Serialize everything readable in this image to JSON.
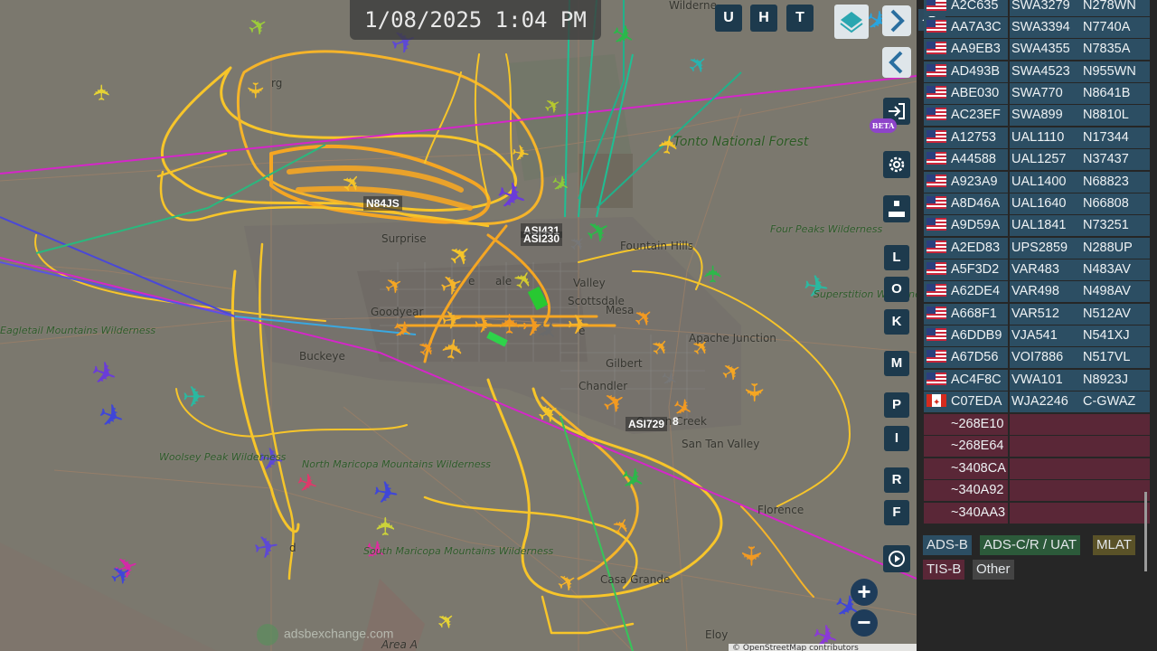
{
  "clock": {
    "datetime": "1/08/2025 1:04 PM"
  },
  "top_buttons": [
    "U",
    "H",
    "T"
  ],
  "side_buttons": [
    "L",
    "O",
    "K",
    "M",
    "P",
    "I",
    "R",
    "F"
  ],
  "beta_label": "BETA",
  "map": {
    "watermark": "adsbexchange.com",
    "attribution": "© OpenStreetMap contributors",
    "places": {
      "surprise": "Surprise",
      "goodyear": "Goodyear",
      "buckeye": "Buckeye",
      "mesa": "Mesa",
      "gilbert": "Gilbert",
      "chandler": "Chandler",
      "fountain_hills": "Fountain Hills",
      "apache_junction": "Apache Junction",
      "san_tan_valley": "San Tan Valley",
      "casa_grande": "Casa Grande",
      "eloy": "Eloy",
      "florence": "Florence",
      "queen_creek": "Queen Creek",
      "scottsdale": "Scottsdale",
      "paradise_valley": "Valley",
      "tonto": "Tonto National Forest",
      "four_peaks": "Four Peaks Wilderness",
      "superstition": "Superstition Wilderness",
      "eagletail": "Eagletail Mountains Wilderness",
      "woolsey": "Woolsey Peak Wilderness",
      "north_maricopa": "North Maricopa Mountains Wilderness",
      "south_maricopa": "South Maricopa Mountains Wilderness",
      "wickenburg": "rg",
      "wilderness_top": "Wilderne",
      "area_a": "Area A",
      "el_mirage": "e",
      "ak_chin": "d",
      "glendale": "ale",
      "tempe": "e"
    },
    "labels": {
      "n84js": "N84JS",
      "asi431": "ASI431",
      "asi230": "ASI230",
      "asi72": "ASI729",
      "asi8": "8"
    }
  },
  "aircraft_table": [
    {
      "hex": "A2C635",
      "callsign": "SWA3279",
      "reg": "N278WN",
      "flag": "us"
    },
    {
      "hex": "AA7A3C",
      "callsign": "SWA3394",
      "reg": "N7740A",
      "flag": "us"
    },
    {
      "hex": "AA9EB3",
      "callsign": "SWA4355",
      "reg": "N7835A",
      "flag": "us"
    },
    {
      "hex": "AD493B",
      "callsign": "SWA4523",
      "reg": "N955WN",
      "flag": "us"
    },
    {
      "hex": "ABE030",
      "callsign": "SWA770",
      "reg": "N8641B",
      "flag": "us"
    },
    {
      "hex": "AC23EF",
      "callsign": "SWA899",
      "reg": "N8810L",
      "flag": "us"
    },
    {
      "hex": "A12753",
      "callsign": "UAL1110",
      "reg": "N17344",
      "flag": "us"
    },
    {
      "hex": "A44588",
      "callsign": "UAL1257",
      "reg": "N37437",
      "flag": "us"
    },
    {
      "hex": "A923A9",
      "callsign": "UAL1400",
      "reg": "N68823",
      "flag": "us"
    },
    {
      "hex": "A8D46A",
      "callsign": "UAL1640",
      "reg": "N66808",
      "flag": "us"
    },
    {
      "hex": "A9D59A",
      "callsign": "UAL1841",
      "reg": "N73251",
      "flag": "us"
    },
    {
      "hex": "A2ED83",
      "callsign": "UPS2859",
      "reg": "N288UP",
      "flag": "us"
    },
    {
      "hex": "A5F3D2",
      "callsign": "VAR483",
      "reg": "N483AV",
      "flag": "us"
    },
    {
      "hex": "A62DE4",
      "callsign": "VAR498",
      "reg": "N498AV",
      "flag": "us"
    },
    {
      "hex": "A668F1",
      "callsign": "VAR512",
      "reg": "N512AV",
      "flag": "us"
    },
    {
      "hex": "A6DDB9",
      "callsign": "VJA541",
      "reg": "N541XJ",
      "flag": "us"
    },
    {
      "hex": "A67D56",
      "callsign": "VOI7886",
      "reg": "N517VL",
      "flag": "us"
    },
    {
      "hex": "AC4F8C",
      "callsign": "VWA101",
      "reg": "N8923J",
      "flag": "us"
    },
    {
      "hex": "C07EDA",
      "callsign": "WJA2246",
      "reg": "C-GWAZ",
      "flag": "ca"
    },
    {
      "hex": "~268E10",
      "callsign": "",
      "reg": "",
      "flag": "none",
      "tis": true
    },
    {
      "hex": "~268E64",
      "callsign": "",
      "reg": "",
      "flag": "none",
      "tis": true
    },
    {
      "hex": "~3408CA",
      "callsign": "",
      "reg": "",
      "flag": "none",
      "tis": true
    },
    {
      "hex": "~340A92",
      "callsign": "",
      "reg": "",
      "flag": "none",
      "tis": true
    },
    {
      "hex": "~340AA3",
      "callsign": "",
      "reg": "",
      "flag": "none",
      "tis": true
    }
  ],
  "legend": [
    {
      "label": "ADS-B",
      "color": "#2c4e63"
    },
    {
      "label": "ADS-C/R / UAT",
      "color": "#2c5a3a"
    },
    {
      "label": "MLAT",
      "color": "#5a5228"
    },
    {
      "label": "TIS-B",
      "color": "#5a2737"
    },
    {
      "label": "Other",
      "color": "#444444"
    }
  ],
  "colors": {
    "track_low": "#f5a623",
    "track_mid": "#f7c52a",
    "button_dark": "#1d3a4d",
    "adsb_row": "#2c4e63",
    "tis_row": "#5a2737"
  }
}
